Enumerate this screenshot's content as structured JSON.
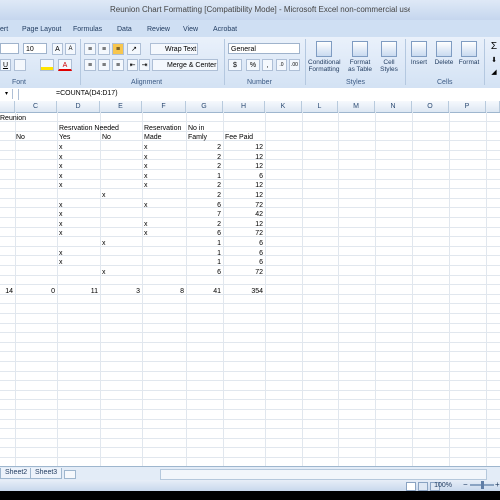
{
  "window": {
    "title": "Reunion Chart Formatting  [Compatibility Mode] - Microsoft Excel non-commercial use"
  },
  "menu": [
    "ert",
    "Page Layout",
    "Formulas",
    "Data",
    "Review",
    "View",
    "Acrobat"
  ],
  "ribbon": {
    "font_size": "10",
    "grow_font": "A",
    "shrink_font": "A",
    "underline": "U",
    "wrap_text": "Wrap Text",
    "merge_center": "Merge & Center",
    "number_format": "General",
    "currency": "$",
    "percent": "%",
    "comma": ",",
    "group_font": "Font",
    "group_alignment": "Alignment",
    "group_number": "Number",
    "group_styles": "Styles",
    "group_cells": "Cells",
    "conditional_formatting": [
      "Conditional",
      "Formatting"
    ],
    "format_as_table": [
      "Format",
      "as Table"
    ],
    "cell_styles": [
      "Cell",
      "Styles"
    ],
    "insert": "Insert",
    "delete": "Delete",
    "format": "Format"
  },
  "formula": {
    "text": "=COUNTA(D4:D17)"
  },
  "columns": [
    "C",
    "D",
    "E",
    "F",
    "G",
    "H",
    "K",
    "L",
    "M",
    "N",
    "O",
    "P"
  ],
  "sheet": {
    "title": "Reunion",
    "h_resv_needed": "Resrvation Needed",
    "h_reservation": "Reservation",
    "h_no_in": "No in",
    "h_no": "No",
    "h_yes": "Yes",
    "h_no2": "No",
    "h_made": "Made",
    "h_family": "Famly",
    "h_fee": "Fee Paid",
    "rows": [
      {
        "d": "x",
        "e": "",
        "f": "x",
        "g": "2",
        "h": "12"
      },
      {
        "d": "x",
        "e": "",
        "f": "x",
        "g": "2",
        "h": "12"
      },
      {
        "d": "x",
        "e": "",
        "f": "x",
        "g": "2",
        "h": "12"
      },
      {
        "d": "x",
        "e": "",
        "f": "x",
        "g": "1",
        "h": "6"
      },
      {
        "d": "x",
        "e": "",
        "f": "x",
        "g": "2",
        "h": "12"
      },
      {
        "d": "",
        "e": "x",
        "f": "",
        "g": "2",
        "h": "12"
      },
      {
        "d": "x",
        "e": "",
        "f": "x",
        "g": "6",
        "h": "72"
      },
      {
        "d": "x",
        "e": "",
        "f": "",
        "g": "7",
        "h": "42"
      },
      {
        "d": "x",
        "e": "",
        "f": "x",
        "g": "2",
        "h": "12"
      },
      {
        "d": "x",
        "e": "",
        "f": "x",
        "g": "6",
        "h": "72"
      },
      {
        "d": "",
        "e": "x",
        "f": "",
        "g": "1",
        "h": "6"
      },
      {
        "d": "x",
        "e": "",
        "f": "",
        "g": "1",
        "h": "6"
      },
      {
        "d": "x",
        "e": "",
        "f": "",
        "g": "1",
        "h": "6"
      },
      {
        "d": "",
        "e": "x",
        "f": "",
        "g": "6",
        "h": "72"
      }
    ],
    "totals": {
      "b": "14",
      "c": "0",
      "d": "11",
      "e": "3",
      "f": "8",
      "g": "41",
      "h": "354"
    }
  },
  "tabs": [
    "Sheet2",
    "Sheet3"
  ],
  "status": {
    "zoom": "100%"
  },
  "icons": [
    "grow-font-icon",
    "shrink-font-icon",
    "fill-color-icon",
    "font-color-icon",
    "align-left-icon",
    "align-center-icon",
    "align-right-icon",
    "indent-icon",
    "orientation-icon",
    "wrap-text-icon",
    "merge-icon",
    "currency-icon",
    "percent-icon",
    "comma-icon",
    "decimal-icon",
    "conditional-formatting-icon",
    "format-table-icon",
    "cell-styles-icon",
    "insert-icon",
    "delete-icon",
    "format-icon",
    "sum-icon",
    "fill-icon",
    "clear-icon"
  ]
}
